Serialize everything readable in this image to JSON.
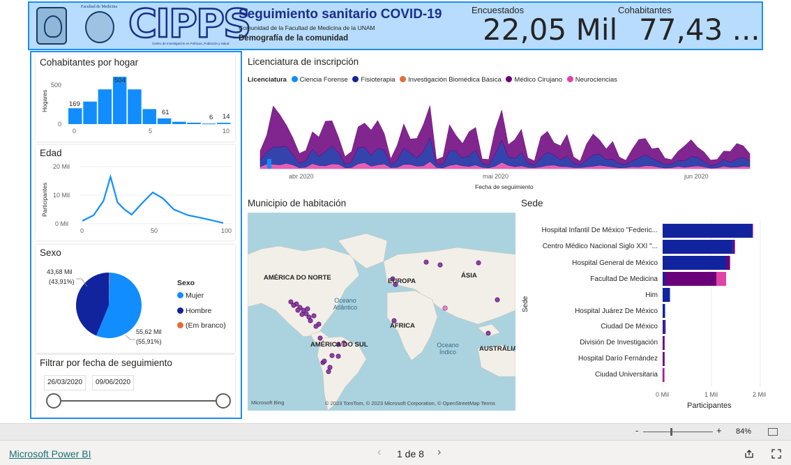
{
  "header": {
    "fac_label": "Facultad de Medicina",
    "cipps_mark": "CIPPS",
    "cipps_sub": "Centro de Investigación en Políticas, Población y Salud",
    "title": "Seguimiento sanitario COVID-19",
    "subtitle": "Comunidad de la Facultad de Medicina de la UNAM",
    "subtitle2": "Demografía de la comunidad",
    "kpi1_label": "Encuestados",
    "kpi1_value": "22,05 Mil",
    "kpi2_label": "Cohabitantes",
    "kpi2_value": "77,43 ..."
  },
  "cohab": {
    "title": "Cohabitantes por hogar",
    "ylabel": "Hogares",
    "yticks": [
      "500",
      "0"
    ],
    "xticks": [
      "0",
      "5",
      "10"
    ],
    "labels": [
      "169",
      "504",
      "61",
      "6",
      "14"
    ]
  },
  "edad": {
    "title": "Edad",
    "ylabel": "Participantes",
    "yticks": [
      "20 Mil",
      "10 Mil",
      "0 Mil"
    ],
    "xticks": [
      "0",
      "50",
      "100"
    ]
  },
  "sexo": {
    "title": "Sexo",
    "legend_title": "Sexo",
    "label1_a": "43,68 Mil",
    "label1_b": "(43,91%)",
    "label2_a": "55,62 Mil",
    "label2_b": "(55,91%)",
    "legend": [
      {
        "label": "Mujer",
        "color": "#118dff"
      },
      {
        "label": "Hombre",
        "color": "#12239e"
      },
      {
        "label": "(Em branco)",
        "color": "#e66c37"
      }
    ]
  },
  "filtro": {
    "title": "Filtrar por fecha de seguimiento",
    "start": "26/03/2020",
    "end": "09/06/2020"
  },
  "lic": {
    "title": "Licenciatura de inscripción",
    "legend_title": "Licenciatura",
    "legend": [
      {
        "label": "Ciencia Forense",
        "color": "#118dff"
      },
      {
        "label": "Fisioterapia",
        "color": "#12239e"
      },
      {
        "label": "Investigación Biomédica Básica",
        "color": "#e66c37"
      },
      {
        "label": "Médico Cirujano",
        "color": "#6b007b"
      },
      {
        "label": "Neurociencias",
        "color": "#e044a7"
      }
    ],
    "xticks": [
      "abr 2020",
      "mai 2020",
      "jun 2020"
    ],
    "xlabel": "Fecha de seguimiento"
  },
  "mapa": {
    "title": "Municipio de habitación",
    "labels": [
      "AMÉRICA DO NORTE",
      "EUROPA",
      "ÁSIA",
      "ÁFRICA",
      "AMÉRICA DO SUL",
      "AUSTRÁLIA"
    ],
    "oceans": [
      "Oceano Atlântico",
      "Oceano Índico"
    ],
    "bing": "Microsoft Bing",
    "copyright": "© 2023 TomTom, © 2023 Microsoft Corporation, © OpenStreetMap  Terms"
  },
  "sede": {
    "title": "Sede",
    "ylabel": "Sede",
    "xlabel": "Participantes",
    "xticks": [
      "0 Mil",
      "1 Mil",
      "2 Mil"
    ],
    "categories": [
      "Hospital Infantil De México \"Federic...",
      "Centro Médico Nacional Siglo XXI \"...",
      "Hospital General de México",
      "Facultad De Medicina",
      "Him",
      "Hospital Juárez De México",
      "Ciudad De México",
      "División De Investigación",
      "Hospital Darío Fernández",
      "Ciudad Universitaria"
    ]
  },
  "chart_data": [
    {
      "type": "bar",
      "title": "Cohabitantes por hogar",
      "ylabel": "Hogares",
      "categories": [
        0,
        1,
        2,
        3,
        4,
        5,
        6,
        7,
        8,
        9,
        10
      ],
      "values": [
        169,
        240,
        370,
        504,
        370,
        160,
        61,
        25,
        15,
        6,
        14
      ],
      "ylim": [
        0,
        520
      ]
    },
    {
      "type": "line",
      "title": "Edad",
      "ylabel": "Participantes",
      "x": [
        0,
        8,
        15,
        20,
        25,
        30,
        35,
        42,
        50,
        57,
        65,
        75,
        85,
        100
      ],
      "y": [
        1000,
        3000,
        8000,
        16500,
        7500,
        5000,
        3200,
        7000,
        11000,
        9000,
        5000,
        3000,
        2000,
        300
      ],
      "ylim": [
        0,
        22000
      ],
      "xlim": [
        0,
        100
      ]
    },
    {
      "type": "pie",
      "title": "Sexo",
      "series": [
        {
          "name": "Mujer",
          "values": [
            55.62
          ]
        },
        {
          "name": "Hombre",
          "values": [
            43.68
          ]
        },
        {
          "name": "(Em branco)",
          "values": [
            0.18
          ]
        }
      ]
    },
    {
      "type": "area",
      "title": "Licenciatura de inscripción",
      "xlabel": "Fecha de seguimiento",
      "x": [
        "2020-03-26",
        "2020-06-09"
      ],
      "series": [
        {
          "name": "Ciencia Forense"
        },
        {
          "name": "Fisioterapia"
        },
        {
          "name": "Investigación Biomédica Básica"
        },
        {
          "name": "Médico Cirujano"
        },
        {
          "name": "Neurociencias"
        }
      ]
    },
    {
      "type": "bar",
      "title": "Sede",
      "xlabel": "Participantes",
      "ylabel": "Sede",
      "categories": [
        "Hospital Infantil De México \"Federic...",
        "Centro Médico Nacional Siglo XXI \"...",
        "Hospital General de México",
        "Facultad De Medicina",
        "Him",
        "Hospital Juárez De México",
        "Ciudad De México",
        "División De Investigación",
        "Hospital Darío Fernández",
        "Ciudad Universitaria"
      ],
      "series": [
        {
          "name": "Fisioterapia",
          "values": [
            1830,
            1440,
            1300,
            50,
            150,
            50,
            40,
            0,
            0,
            0
          ]
        },
        {
          "name": "Médico Cirujano",
          "values": [
            20,
            40,
            80,
            1050,
            0,
            0,
            20,
            40,
            40,
            20
          ]
        },
        {
          "name": "Neurociencias",
          "values": [
            0,
            0,
            0,
            200,
            0,
            0,
            0,
            0,
            0,
            20
          ]
        }
      ],
      "xlim": [
        0,
        2000
      ]
    }
  ],
  "zoom": {
    "value": "84%",
    "minus": "-",
    "plus": "+"
  },
  "footer": {
    "brand": "Microsoft Power BI",
    "pager": "1 de 8"
  }
}
